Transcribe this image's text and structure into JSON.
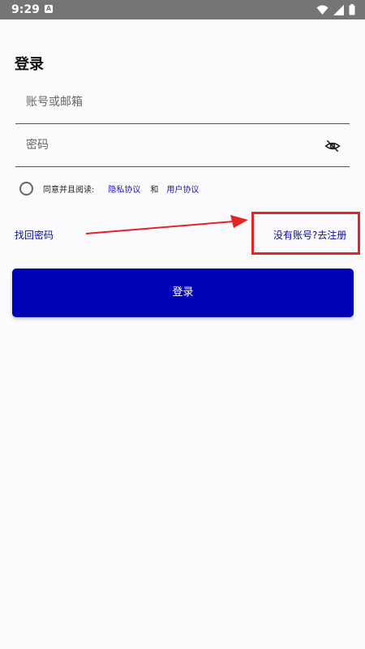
{
  "status_bar": {
    "time": "9:29",
    "notification_icon": "a-icon"
  },
  "page": {
    "title": "登录"
  },
  "fields": {
    "account_placeholder": "账号或邮箱",
    "password_placeholder": "密码"
  },
  "agreement": {
    "prefix": "同意并且阅读:",
    "privacy": "隐私协议",
    "conjunction": "和",
    "user": "用户协议"
  },
  "links": {
    "forgot_password": "找回密码",
    "register": "没有账号?去注册"
  },
  "button": {
    "login": "登录"
  },
  "colors": {
    "accent": "#0000b4",
    "annotation": "#e52424"
  }
}
